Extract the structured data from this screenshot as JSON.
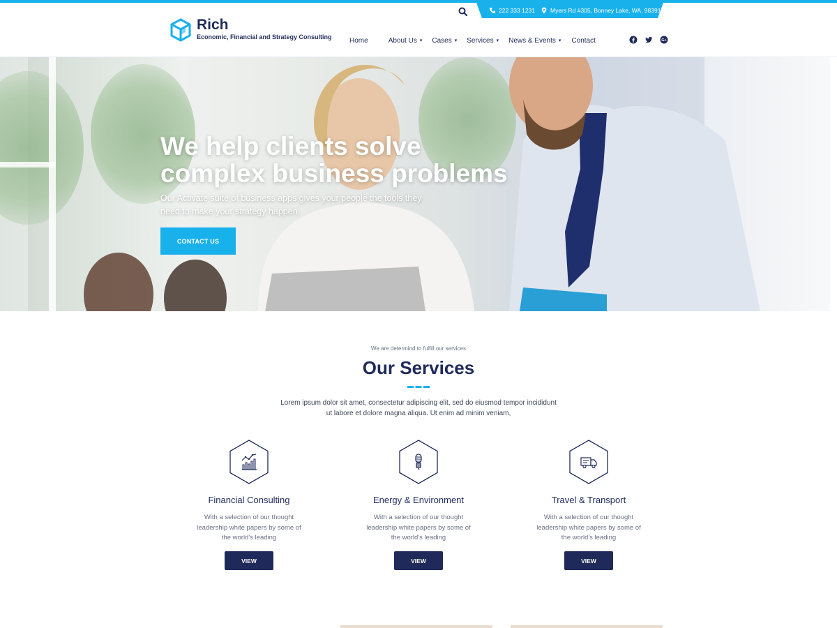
{
  "brand": {
    "name": "Rich",
    "tagline": "Economic, Financial and Strategy Consulting"
  },
  "topbar": {
    "phone": "222 333 1231",
    "address": "Myers Rd #305, Bonney Lake, WA, 98391"
  },
  "nav": {
    "items": [
      {
        "label": "Home",
        "has_dropdown": false,
        "active": true
      },
      {
        "label": "About Us",
        "has_dropdown": true,
        "active": false
      },
      {
        "label": "Cases",
        "has_dropdown": true,
        "active": false
      },
      {
        "label": "Services",
        "has_dropdown": true,
        "active": false
      },
      {
        "label": "News & Events",
        "has_dropdown": true,
        "active": false
      },
      {
        "label": "Contact",
        "has_dropdown": false,
        "active": false
      }
    ],
    "caret": "▾",
    "social_icons": [
      "facebook-icon",
      "twitter-icon",
      "google-plus-icon"
    ]
  },
  "hero": {
    "title_line1": "We help clients solve",
    "title_line2": "complex business problems",
    "subtitle": "Our Activate suite of business apps gives your people the tools they need to make your strategy happen.",
    "cta_label": "CONTACT US"
  },
  "services": {
    "kicker": "We are determind to fulfill our services",
    "title": "Our Services",
    "description": "Lorem ipsum dolor sit amet, consectetur adipiscing elit, sed do eiusmod tempor incididunt ut labore et dolore magna aliqua. Ut enim ad minim veniam,",
    "cards": [
      {
        "icon": "chart-icon",
        "title": "Financial Consulting",
        "text": "With a selection of our thought leadership white papers by some of the world's leading",
        "button": "VIEW"
      },
      {
        "icon": "lightbulb-icon",
        "title": "Energy & Environment",
        "text": "With a selection of our thought leadership white papers by some of the world's leading",
        "button": "VIEW"
      },
      {
        "icon": "truck-icon",
        "title": "Travel & Transport",
        "text": "With a selection of our thought leadership white papers by some of the world's leading",
        "button": "VIEW"
      }
    ]
  },
  "colors": {
    "accent": "#19b1ec",
    "navy": "#1f2a5a",
    "text_muted": "#6a7185"
  }
}
